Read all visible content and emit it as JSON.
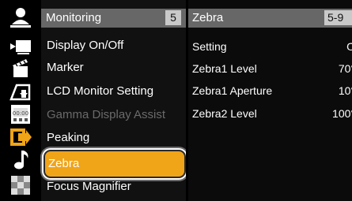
{
  "menu": {
    "title": "Monitoring",
    "page": "5",
    "items": [
      {
        "label": "Display On/Off",
        "state": "normal",
        "icon": "tv-play-icon"
      },
      {
        "label": "Marker",
        "state": "normal",
        "icon": "clapperboard-icon"
      },
      {
        "label": "LCD Monitor Setting",
        "state": "normal",
        "icon": "monitor-screen-icon"
      },
      {
        "label": "Gamma Display Assist",
        "state": "disabled",
        "icon": "grid-display-icon"
      },
      {
        "label": "Peaking",
        "state": "normal",
        "icon": "output-arrow-icon"
      },
      {
        "label": "Zebra",
        "state": "selected",
        "icon": "music-note-icon"
      },
      {
        "label": "Focus Magnifier",
        "state": "normal",
        "icon": "checkerboard-icon"
      }
    ]
  },
  "submenu": {
    "title": "Zebra",
    "page": "5-9",
    "rows": [
      {
        "setting": "Setting",
        "value": "O"
      },
      {
        "setting": "Zebra1 Level",
        "value": "70°"
      },
      {
        "setting": "Zebra1 Aperture",
        "value": "10°"
      },
      {
        "setting": "Zebra2 Level",
        "value": "100°"
      }
    ]
  },
  "colors": {
    "accent": "#f0a418",
    "header": "#676767",
    "background": "#000000"
  }
}
